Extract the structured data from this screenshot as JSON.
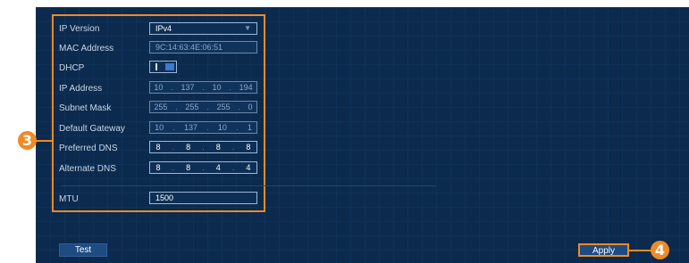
{
  "form": {
    "ip_version": {
      "label": "IP Version",
      "value": "IPv4"
    },
    "mac_address": {
      "label": "MAC Address",
      "value": "9C:14:63:4E:06:51"
    },
    "dhcp": {
      "label": "DHCP",
      "on_text": "I",
      "enabled": true
    },
    "ip_address": {
      "label": "IP Address",
      "octets": [
        "10",
        "137",
        "10",
        "194"
      ]
    },
    "subnet_mask": {
      "label": "Subnet Mask",
      "octets": [
        "255",
        "255",
        "255",
        "0"
      ]
    },
    "default_gateway": {
      "label": "Default Gateway",
      "octets": [
        "10",
        "137",
        "10",
        "1"
      ]
    },
    "preferred_dns": {
      "label": "Preferred DNS",
      "octets": [
        "8",
        "8",
        "8",
        "8"
      ]
    },
    "alternate_dns": {
      "label": "Alternate DNS",
      "octets": [
        "8",
        "8",
        "4",
        "4"
      ]
    },
    "mtu": {
      "label": "MTU",
      "value": "1500"
    }
  },
  "buttons": {
    "test": "Test",
    "apply": "Apply"
  },
  "badges": {
    "form": "3",
    "apply": "4"
  },
  "colors": {
    "highlight": "#f08a24",
    "background": "#0b2a4e",
    "button": "#1d4b82"
  }
}
